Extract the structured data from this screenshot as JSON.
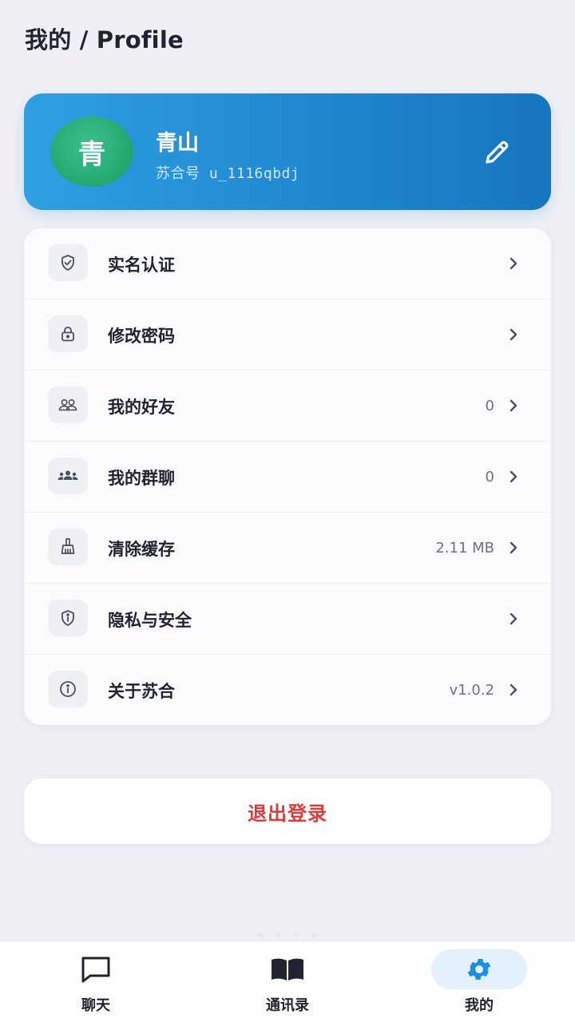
{
  "header": {
    "title": "我的 / Profile"
  },
  "profile": {
    "avatar_char": "青",
    "name": "青山",
    "id_label": "苏合号",
    "id_value": "u_1116qbdj",
    "edit_icon": "pencil-icon"
  },
  "menu": [
    {
      "icon": "shield-check-icon",
      "label": "实名认证",
      "value": ""
    },
    {
      "icon": "lock-icon",
      "label": "修改密码",
      "value": ""
    },
    {
      "icon": "friends-icon",
      "label": "我的好友",
      "value": "0"
    },
    {
      "icon": "group-icon",
      "label": "我的群聊",
      "value": "0"
    },
    {
      "icon": "broom-icon",
      "label": "清除缓存",
      "value": "2.11 MB"
    },
    {
      "icon": "shield-info-icon",
      "label": "隐私与安全",
      "value": ""
    },
    {
      "icon": "info-icon",
      "label": "关于苏合",
      "value": "v1.0.2"
    }
  ],
  "logout": {
    "label": "退出登录"
  },
  "nav": [
    {
      "icon": "chat-bubble-icon",
      "label": "聊天",
      "active": false
    },
    {
      "icon": "book-icon",
      "label": "通讯录",
      "active": false
    },
    {
      "icon": "gear-icon",
      "label": "我的",
      "active": true
    }
  ],
  "colors": {
    "accent": "#1e86cf",
    "avatar": "#22a86f",
    "danger": "#e03b3b",
    "active_nav": "#1e8fe0"
  }
}
